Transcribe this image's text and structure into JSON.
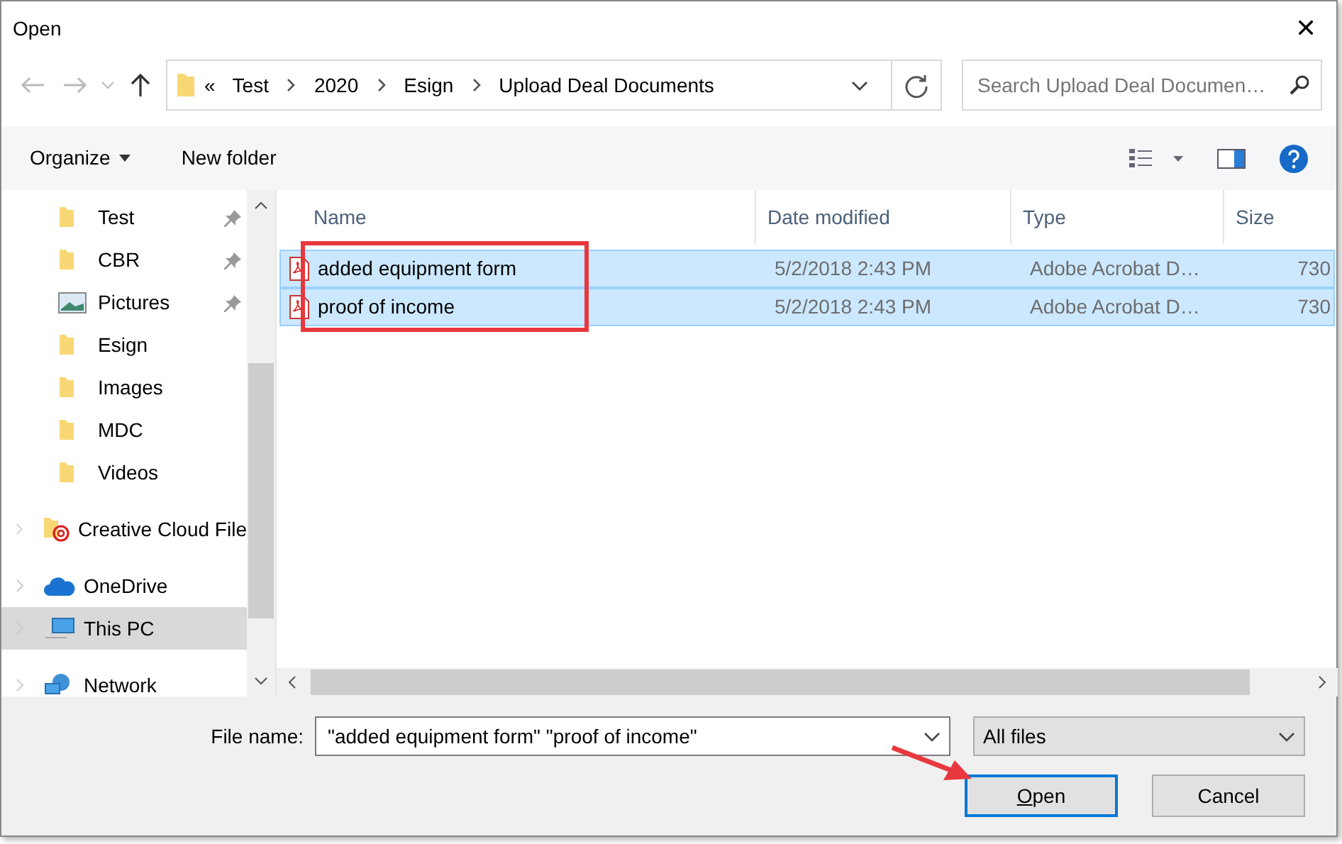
{
  "window": {
    "title": "Open",
    "close": "✕"
  },
  "address": {
    "crumbs": [
      "«",
      "Test",
      "2020",
      "Esign",
      "Upload Deal Documents"
    ]
  },
  "search": {
    "placeholder": "Search Upload Deal Documen…"
  },
  "toolbar": {
    "organize": "Organize",
    "new_folder": "New folder"
  },
  "sidebar": {
    "items": [
      {
        "kind": "folder",
        "label": "Test",
        "pinned": true,
        "selected": false
      },
      {
        "kind": "folder",
        "label": "CBR",
        "pinned": true,
        "selected": false
      },
      {
        "kind": "pictures",
        "label": "Pictures",
        "pinned": true,
        "selected": false
      },
      {
        "kind": "folder",
        "label": "Esign",
        "pinned": false,
        "selected": false
      },
      {
        "kind": "folder",
        "label": "Images",
        "pinned": false,
        "selected": false
      },
      {
        "kind": "folder",
        "label": "MDC",
        "pinned": false,
        "selected": false
      },
      {
        "kind": "folder",
        "label": "Videos",
        "pinned": false,
        "selected": false
      },
      {
        "kind": "cloudfolder",
        "label": "Creative Cloud File",
        "pinned": false,
        "selected": false
      },
      {
        "kind": "onedrive",
        "label": "OneDrive",
        "pinned": false,
        "selected": false
      },
      {
        "kind": "pc",
        "label": "This PC",
        "pinned": false,
        "selected": true
      },
      {
        "kind": "network",
        "label": "Network",
        "pinned": false,
        "selected": false
      }
    ]
  },
  "table": {
    "columns": [
      "Name",
      "Date modified",
      "Type",
      "Size"
    ],
    "rows": [
      {
        "name": "added equipment form",
        "date": "5/2/2018 2:43 PM",
        "type": "Adobe Acrobat D…",
        "size": "730",
        "selected": true
      },
      {
        "name": "proof of income",
        "date": "5/2/2018 2:43 PM",
        "type": "Adobe Acrobat D…",
        "size": "730",
        "selected": true
      }
    ]
  },
  "footer": {
    "file_name_label": "File name:",
    "file_name": "\"added equipment form\" \"proof of income\"",
    "filter": "All files",
    "open": "Open",
    "cancel": "Cancel"
  },
  "annotation": {
    "highlight_box": true,
    "arrow": true
  }
}
